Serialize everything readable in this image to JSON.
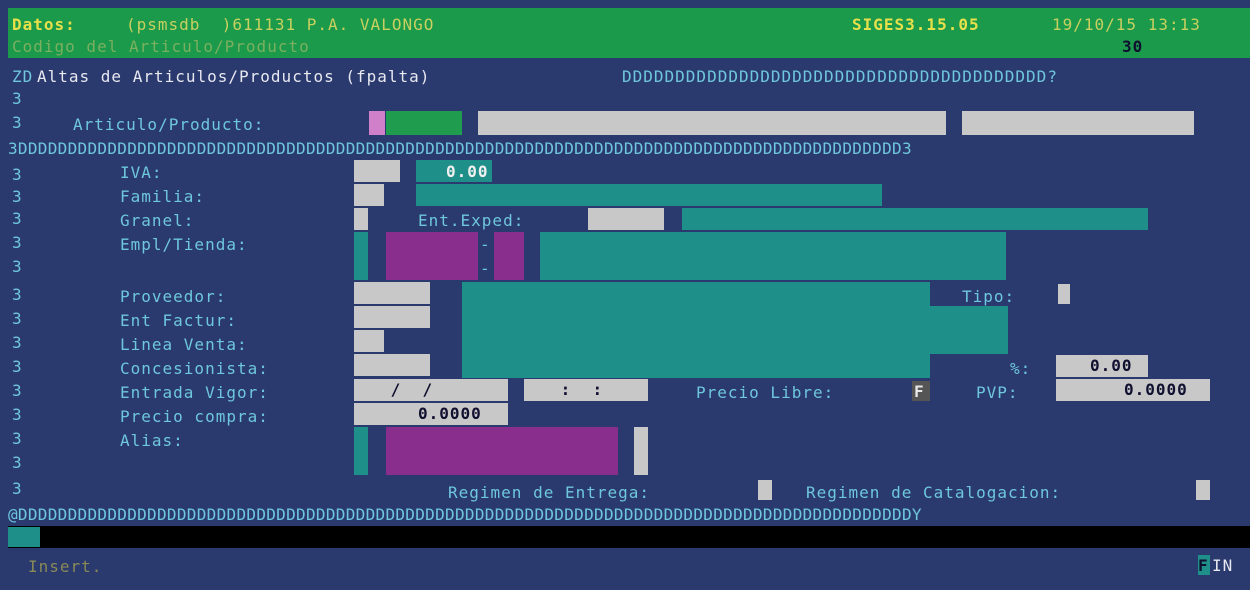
{
  "header": {
    "datos_label": "Datos:",
    "db_info": "(psmsdb  )611131 P.A. VALONGO",
    "version": "SIGES3.15.05",
    "datetime": "19/10/15 13:13",
    "subtitle": "Codigo del Articulo/Producto",
    "count": "30"
  },
  "frame": {
    "top_prefix": "ZD",
    "title": "Altas de Articulos/Productos (fpalta)",
    "top_fill": "DDDDDDDDDDDDDDDDDDDDDDDDDDDDDDDDDDDDDDDD?",
    "divider": "3DDDDDDDDDDDDDDDDDDDDDDDDDDDDDDDDDDDDDDDDDDDDDDDDDDDDDDDDDDDDDDDDDDDDDDDDDDDDDDDDDDDDDDDDD3",
    "bottom": "@DDDDDDDDDDDDDDDDDDDDDDDDDDDDDDDDDDDDDDDDDDDDDDDDDDDDDDDDDDDDDDDDDDDDDDDDDDDDDDDDDDDDDDDDDDY",
    "side_char": "3"
  },
  "form": {
    "articulo_label": "Articulo/Producto:",
    "iva_label": "IVA:",
    "iva_value": "0.00",
    "familia_label": "Familia:",
    "granel_label": "Granel:",
    "ent_exped_label": "Ent.Exped:",
    "empl_label": "Empl/Tienda:",
    "dash": "-",
    "proveedor_label": "Proveedor:",
    "tipo_label": "Tipo:",
    "ent_factur_label": "Ent Factur:",
    "linea_label": "Linea Venta:",
    "concesionista_label": "Concesionista:",
    "pct_label": "%:",
    "pct_value": "0.00",
    "entrada_label": "Entrada Vigor:",
    "date_value": " /  /",
    "time_value": " :  :",
    "precio_libre_label": "Precio Libre:",
    "precio_libre_value": "F",
    "pvp_label": "PVP:",
    "pvp_value": "0.0000",
    "precio_compra_label": "Precio compra:",
    "precio_compra_value": "0.0000",
    "alias_label": "Alias:",
    "regimen_entrega_label": "Regimen de Entrega:",
    "regimen_catalogacion_label": "Regimen de Catalogacion:"
  },
  "status": {
    "mode": "Insert.",
    "fin_f": "F",
    "fin_rest": "IN"
  }
}
